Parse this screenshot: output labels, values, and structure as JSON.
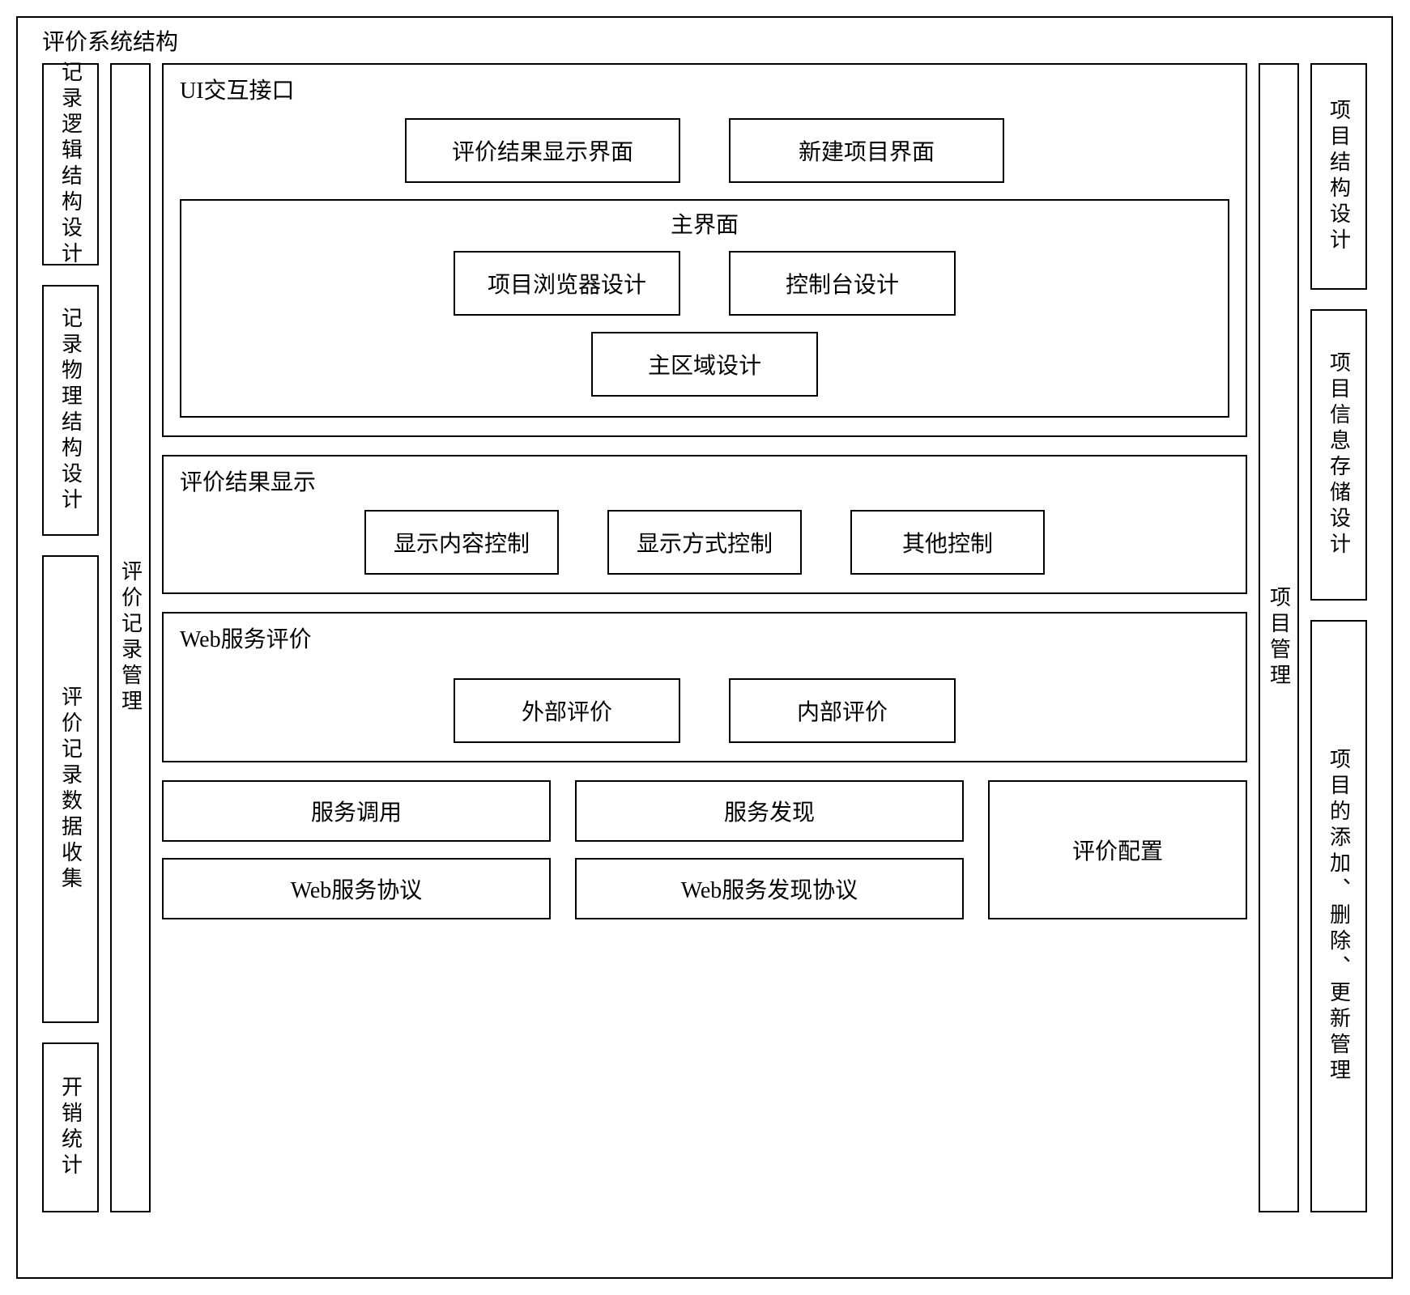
{
  "outer_title": "评价系统结构",
  "left": {
    "manager_label": "评价记录管理",
    "items": [
      "记录逻辑结构设计",
      "记录物理结构设计",
      "评价记录数据收集",
      "开销统计"
    ]
  },
  "right": {
    "manager_label": "项目管理",
    "items": [
      "项目结构设计",
      "项目信息存储设计",
      "项目的添加、删除、更新管理"
    ]
  },
  "center": {
    "ui": {
      "title": "UI交互接口",
      "top_boxes": [
        "评价结果显示界面",
        "新建项目界面"
      ],
      "main_panel": {
        "title": "主界面",
        "row1": [
          "项目浏览器设计",
          "控制台设计"
        ],
        "row2": [
          "主区域设计"
        ]
      }
    },
    "result": {
      "title": "评价结果显示",
      "boxes": [
        "显示内容控制",
        "显示方式控制",
        "其他控制"
      ]
    },
    "web": {
      "title": "Web服务评价",
      "boxes": [
        "外部评价",
        "内部评价"
      ]
    },
    "bottom": {
      "left_rows": [
        [
          "服务调用",
          "服务发现"
        ],
        [
          "Web服务协议",
          "Web服务发现协议"
        ]
      ],
      "right_box": "评价配置"
    }
  }
}
